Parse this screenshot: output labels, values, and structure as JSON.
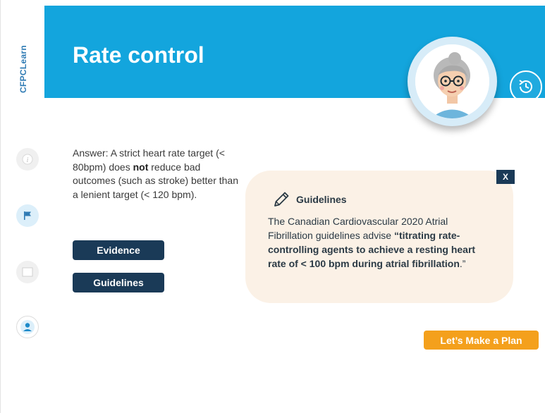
{
  "app": {
    "brand": "CFPCLearn"
  },
  "header": {
    "title": "Rate control"
  },
  "answer": {
    "prefix": "Answer: A strict heart rate target (< 80bpm) does ",
    "emphasis": "not",
    "suffix": " reduce bad outcomes (such as stroke) better than a lenient target (< 120 bpm)."
  },
  "buttons": {
    "evidence": "Evidence",
    "guidelines": "Guidelines",
    "plan": "Let’s Make a Plan"
  },
  "popup": {
    "close": "X",
    "title": "Guidelines",
    "body_plain": "The Canadian Cardiovascular 2020 Atrial Fibrillation guidelines advise ",
    "body_bold": "“titrating rate-controlling agents to achieve a resting heart rate of < 100 bpm during atrial fibrillation",
    "body_end": ".”"
  },
  "icons": {
    "info": "info-icon",
    "flag": "flag-icon",
    "note": "note-icon",
    "user": "user-icon",
    "history": "history-icon",
    "pencil": "pencil-icon"
  },
  "colors": {
    "header": "#13a5dd",
    "dark_button": "#1a3a57",
    "accent_button": "#f4a01c",
    "popup_bg": "#fbf1e6"
  }
}
